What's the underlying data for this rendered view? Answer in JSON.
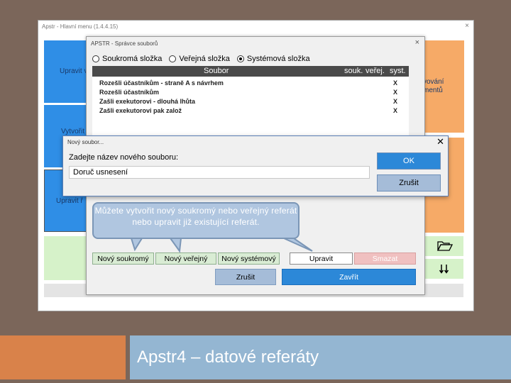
{
  "main_window": {
    "title": "Apstr - Hlavní menu (1.4.4.15)",
    "close": "×",
    "tiles": [
      {
        "label": "Upravit v"
      },
      {
        "label": "Vytvořit"
      },
      {
        "label": "Upravit ř"
      },
      {
        "label": "vování"
      },
      {
        "label": "mentů"
      }
    ]
  },
  "file_manager": {
    "title": "APSTR - Správce souborů",
    "close": "×",
    "radios": [
      {
        "label": "Soukromá složka",
        "selected": false
      },
      {
        "label": "Veřejná složka",
        "selected": false
      },
      {
        "label": "Systémová složka",
        "selected": true
      }
    ],
    "columns": [
      "Soubor",
      "souk.",
      "veřej.",
      "syst."
    ],
    "rows": [
      {
        "name": "Rozešli účastníkům - straně A s návrhem",
        "syst": "X"
      },
      {
        "name": "Rozešli účastníkům",
        "syst": "X"
      },
      {
        "name": "Zašli exekutorovi - dlouhá lhůta",
        "syst": "X"
      },
      {
        "name": "Zašli exekutorovi pak založ",
        "syst": "X"
      }
    ],
    "buttons": {
      "new_private": "Nový soukromý",
      "new_public": "Nový veřejný",
      "new_system": "Nový systémový",
      "edit": "Upravit",
      "delete": "Smazat",
      "cancel": "Zrušit",
      "close": "Zavřít"
    }
  },
  "new_file_dialog": {
    "title": "Nový soubor...",
    "close": "✕",
    "prompt": "Zadejte název nového souboru:",
    "input_value": "Doruč usnesení",
    "ok": "OK",
    "cancel": "Zrušit"
  },
  "callout": {
    "text": "Můžete vytvořit nový soukromý nebo veřejný referát nebo upravit již existující referát."
  },
  "slide_title": "Apstr4 – datové referáty",
  "colors": {
    "tile_blue": "#2f8ee6",
    "tile_orange": "#f6aa67",
    "tile_green": "#d6f2c9",
    "button_blue": "#2c88d8",
    "bottom_orange": "#d9824a",
    "bottom_blue": "#94b6d2"
  },
  "icons": [
    "folder-open-icon",
    "sort-arrows-icon"
  ]
}
